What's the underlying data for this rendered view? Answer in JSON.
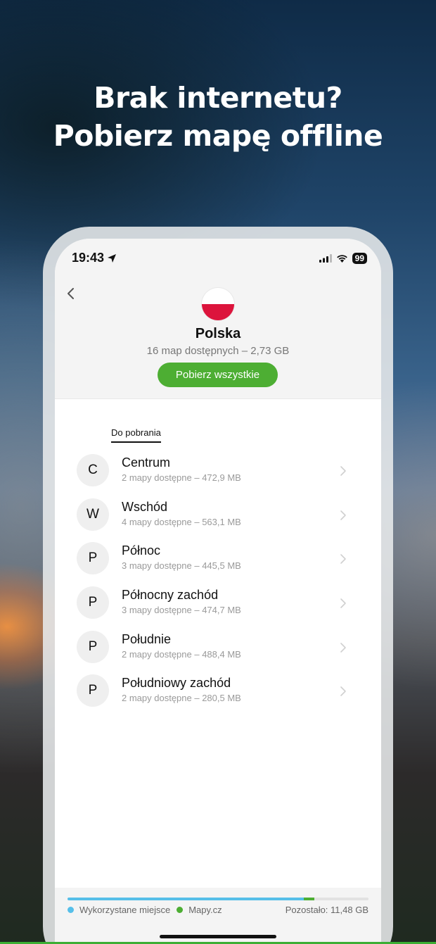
{
  "headline": {
    "line1": "Brak internetu?",
    "line2": "Pobierz mapę offline"
  },
  "status_bar": {
    "time": "19:43",
    "battery": "99"
  },
  "country": {
    "name": "Polska",
    "subtitle": "16 map dostępnych – 2,73 GB",
    "download_all_label": "Pobierz wszystkie",
    "flag_colors": [
      "#ffffff",
      "#dc143c"
    ]
  },
  "tab": {
    "label": "Do pobrania"
  },
  "regions": [
    {
      "initial": "C",
      "name": "Centrum",
      "details": "2 mapy dostępne – 472,9 MB"
    },
    {
      "initial": "W",
      "name": "Wschód",
      "details": "4 mapy dostępne – 563,1 MB"
    },
    {
      "initial": "P",
      "name": "Północ",
      "details": "3 mapy dostępne – 445,5 MB"
    },
    {
      "initial": "P",
      "name": "Północny zachód",
      "details": "3 mapy dostępne – 474,7 MB"
    },
    {
      "initial": "P",
      "name": "Południe",
      "details": "2 mapy dostępne – 488,4 MB"
    },
    {
      "initial": "P",
      "name": "Południowy zachód",
      "details": "2 mapy dostępne – 280,5 MB"
    }
  ],
  "storage": {
    "used_label": "Wykorzystane miejsce",
    "app_label": "Mapy.cz",
    "remaining": "Pozostało: 11,48 GB",
    "used_fraction": 0.785,
    "app_fraction": 0.035,
    "used_color": "#56bfe9",
    "app_color": "#4dae33"
  },
  "colors": {
    "accent": "#4dae33"
  }
}
